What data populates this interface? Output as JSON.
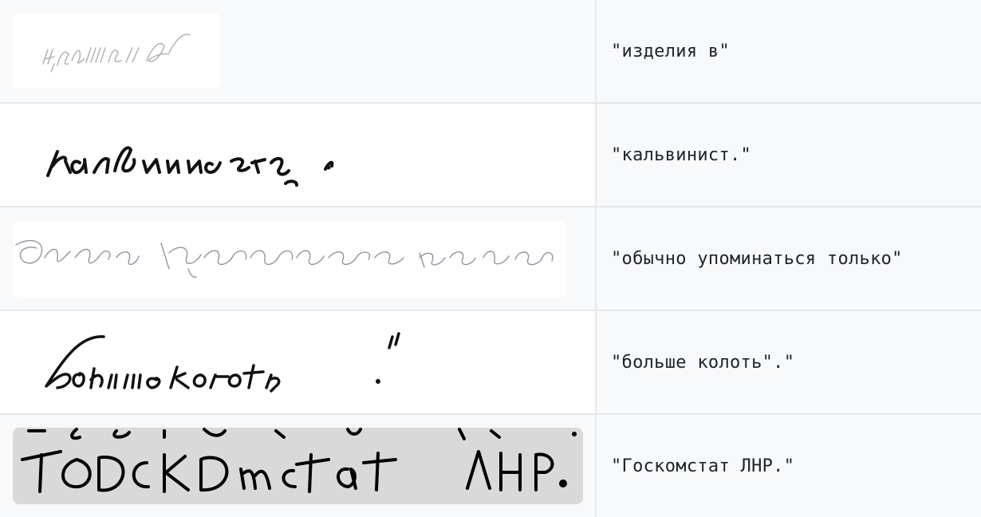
{
  "rows": [
    {
      "image_text": "изделия в",
      "transcription": "\"изделия в\""
    },
    {
      "image_text": "кальвинист.",
      "transcription": "\"кальвинист.\""
    },
    {
      "image_text": "обычно упоминаться только",
      "transcription": "\"обычно упоминаться только\""
    },
    {
      "image_text": "больше колоть\".",
      "transcription": "\"больше колоть\".\""
    },
    {
      "image_text": "Госкомстат ЛНР.",
      "transcription": "\"Госкомстат ЛНР.\""
    }
  ]
}
